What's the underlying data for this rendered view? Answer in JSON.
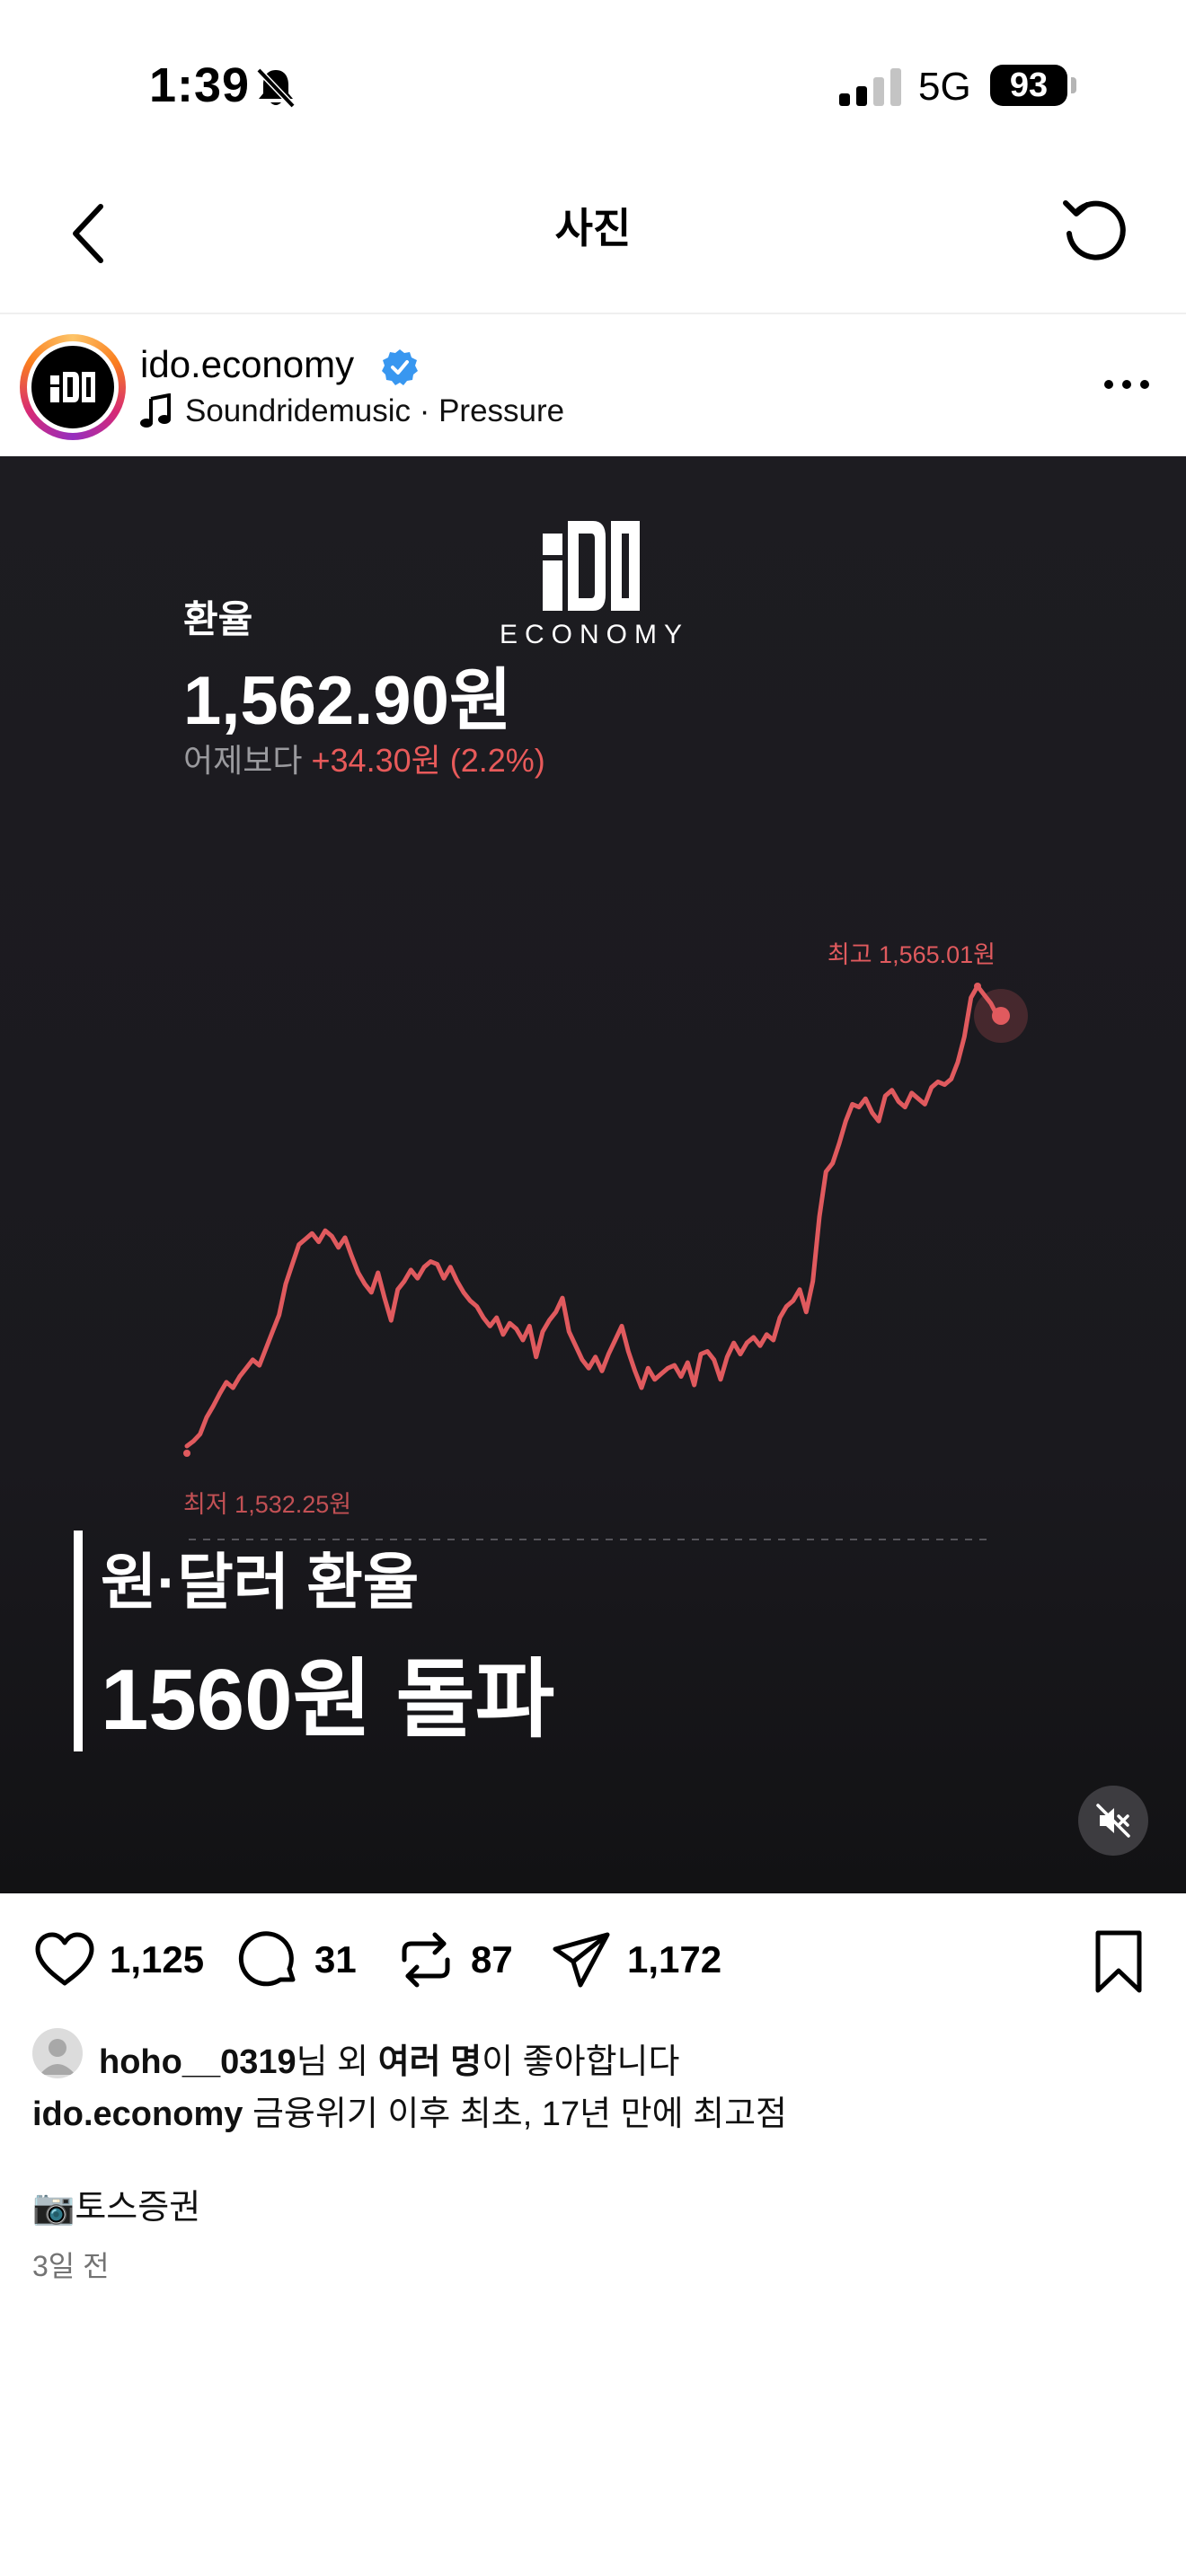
{
  "status_bar": {
    "time": "1:39",
    "network": "5G",
    "battery": "93"
  },
  "nav": {
    "title": "사진"
  },
  "post": {
    "username": "ido.economy",
    "music": "Soundridemusic · Pressure"
  },
  "media": {
    "logo_sub": "ECONOMY",
    "rate_label": "환율",
    "rate_value": "1,562.90원",
    "change_prefix": "어제보다",
    "change_value": "+34.30원 (2.2%)",
    "headline_1": "원·달러 환율",
    "headline_2": "1560원 돌파",
    "accent_color": "#e05a5e"
  },
  "chart_data": {
    "type": "line",
    "title": "",
    "series": [
      {
        "values": [
          1532.25,
          1532.6,
          1533.1,
          1534.3,
          1535.1,
          1536.0,
          1536.8,
          1536.4,
          1537.2,
          1537.8,
          1538.4,
          1538.0,
          1539.2,
          1540.4,
          1541.6,
          1543.8,
          1545.2,
          1546.6,
          1547.0,
          1547.4,
          1546.8,
          1547.6,
          1547.2,
          1546.4,
          1547.1,
          1545.8,
          1544.6,
          1543.8,
          1543.2,
          1544.6,
          1542.8,
          1541.2,
          1543.4,
          1544.0,
          1544.8,
          1544.2,
          1545.0,
          1545.4,
          1545.2,
          1544.2,
          1545.0,
          1544.0,
          1543.2,
          1542.6,
          1542.2,
          1541.4,
          1540.8,
          1541.4,
          1540.2,
          1541.0,
          1540.6,
          1539.8,
          1540.8,
          1538.6,
          1540.4,
          1541.2,
          1541.8,
          1542.8,
          1540.4,
          1539.4,
          1538.4,
          1537.8,
          1538.6,
          1537.6,
          1538.8,
          1539.8,
          1540.8,
          1539.0,
          1537.6,
          1536.4,
          1537.8,
          1537.0,
          1537.4,
          1537.8,
          1538.0,
          1537.2,
          1538.2,
          1536.6,
          1538.8,
          1539.0,
          1538.4,
          1537.0,
          1538.6,
          1539.6,
          1538.8,
          1539.6,
          1540.0,
          1539.4,
          1540.2,
          1539.8,
          1541.4,
          1542.2,
          1542.6,
          1543.4,
          1541.8,
          1544.0,
          1548.6,
          1551.8,
          1552.4,
          1553.8,
          1555.4,
          1556.6,
          1556.4,
          1557.0,
          1556.0,
          1555.4,
          1557.2,
          1557.6,
          1556.8,
          1556.4,
          1557.4,
          1557.0,
          1556.6,
          1557.8,
          1558.2,
          1558.0,
          1558.4,
          1559.6,
          1561.4,
          1564.2,
          1565.01,
          1564.4,
          1563.8,
          1562.9
        ]
      }
    ],
    "annotations": {
      "max_label": "최고 1,565.01원",
      "min_label": "최저 1,532.25원"
    },
    "max": 1565.01,
    "min": 1532.25,
    "grid": false
  },
  "actions": {
    "likes": "1,125",
    "comments": "31",
    "reposts": "87",
    "shares": "1,172"
  },
  "caption": {
    "liker": "hoho__0319",
    "likes_suffix_1": "님 외 ",
    "likes_bold": "여러 명",
    "likes_suffix_2": "이 좋아합니다",
    "username": "ido.economy",
    "text": "금융위기 이후 최초, 17년 만에 최고점",
    "line2": "📷토스증권",
    "time": "3일 전"
  }
}
